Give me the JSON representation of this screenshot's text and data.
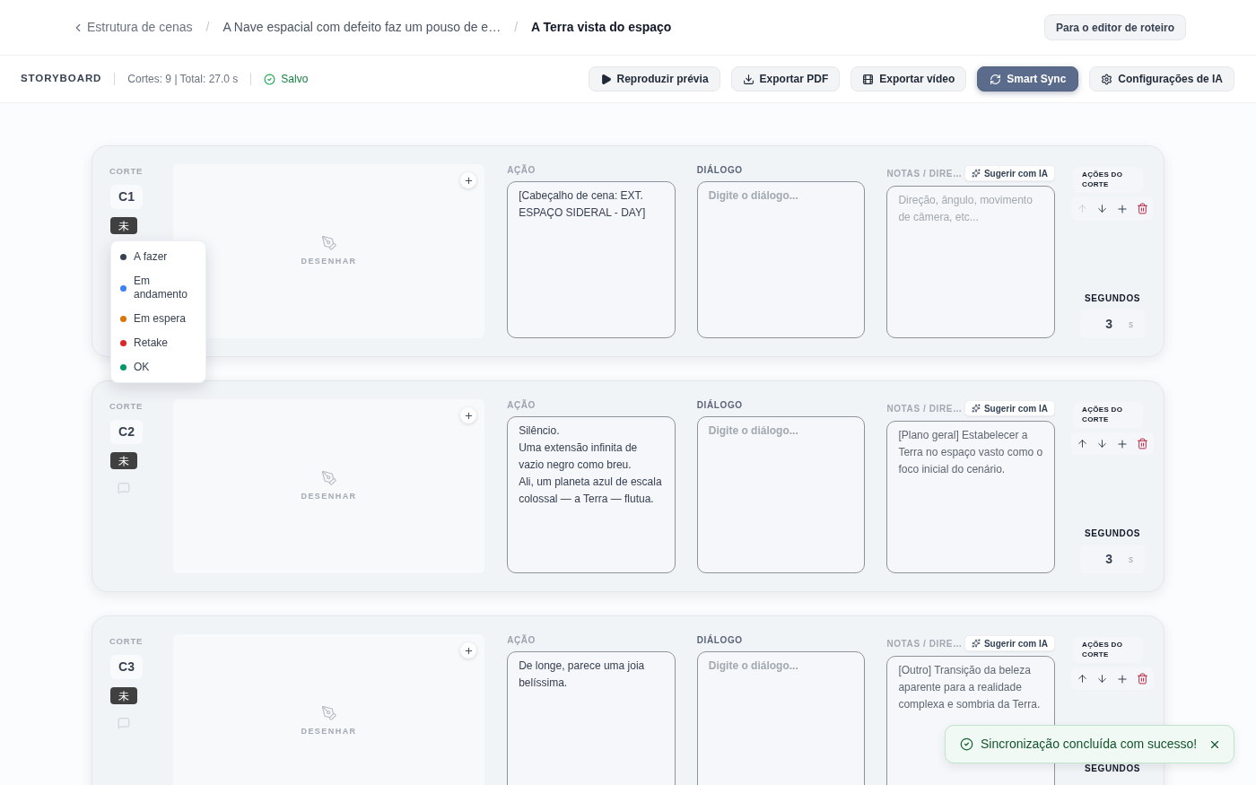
{
  "breadcrumb": {
    "back": "Estrutura de cenas",
    "items": [
      {
        "separator": "/",
        "label": "A Nave espacial com defeito faz um pouso de e…",
        "current": false
      },
      {
        "separator": "/",
        "label": "A Terra vista do espaço",
        "current": true
      }
    ]
  },
  "header_button": "Para o editor de roteiro",
  "toolbar": {
    "title": "STORYBOARD",
    "stats": "Cortes: 9 | Total: 27.0 s",
    "save_status": "Salvo",
    "buttons": [
      {
        "kind": "play",
        "label": "Reproduzir prévia",
        "primary": false
      },
      {
        "kind": "pdf",
        "label": "Exportar PDF",
        "primary": false
      },
      {
        "kind": "video",
        "label": "Exportar vídeo",
        "primary": false
      },
      {
        "kind": "sync",
        "label": "Smart Sync",
        "primary": true
      },
      {
        "kind": "settings",
        "label": "Configurações de IA",
        "primary": false
      }
    ]
  },
  "cuts": [
    {
      "cut_label": "CORTE",
      "number": "C1",
      "status": "未",
      "status_menu": [
        {
          "label": "A fazer",
          "color": "#374151"
        },
        {
          "label": "Em andamento",
          "color": "#3b82f6"
        },
        {
          "label": "Em espera",
          "color": "#d97706"
        },
        {
          "label": "Retake",
          "color": "#dc2626"
        },
        {
          "label": "OK",
          "color": "#059669"
        }
      ],
      "drawing_label": "DESENHAR",
      "action": {
        "label": "AÇÃO",
        "value": "[Cabeçalho de cena: EXT. ESPAÇO SIDERAL - DAY]"
      },
      "dialogue": {
        "label": "DIÁLOGO",
        "placeholder": "Digite o diálogo..."
      },
      "notes": {
        "label": "NOTAS / DIRE…",
        "suggest": "Sugerir com IA",
        "placeholder": "Direção, ângulo, movimento de câmera, etc..."
      },
      "actions_label": "AÇÕES DO CORTE",
      "move_up_disabled": true,
      "seconds_label": "SEGUNDOS",
      "seconds": "3",
      "seconds_unit": "s"
    },
    {
      "cut_label": "CORTE",
      "number": "C2",
      "status": "未",
      "drawing_label": "DESENHAR",
      "action": {
        "label": "AÇÃO",
        "value": "Silêncio.\nUma extensão infinita de vazio negro como breu.\nAli, um planeta azul de escala colossal — a Terra — flutua."
      },
      "dialogue": {
        "label": "DIÁLOGO",
        "placeholder": "Digite o diálogo..."
      },
      "notes": {
        "label": "NOTAS / DIRE…",
        "suggest": "Sugerir com IA",
        "value": "[Plano geral] Estabelecer a Terra no espaço vasto como o foco inicial do cenário."
      },
      "actions_label": "AÇÕES DO CORTE",
      "move_up_disabled": false,
      "seconds_label": "SEGUNDOS",
      "seconds": "3",
      "seconds_unit": "s"
    },
    {
      "cut_label": "CORTE",
      "number": "C3",
      "status": "未",
      "drawing_label": "DESENHAR",
      "action": {
        "label": "AÇÃO",
        "value": "De longe, parece uma joia belíssima."
      },
      "dialogue": {
        "label": "DIÁLOGO",
        "placeholder": "Digite o diálogo..."
      },
      "notes": {
        "label": "NOTAS / DIRE…",
        "suggest": "Sugerir com IA",
        "value": "[Outro] Transição da beleza aparente para a realidade complexa e sombria da Terra."
      },
      "actions_label": "AÇÕES DO CORTE",
      "move_up_disabled": false,
      "seconds_label": "SEGUNDOS"
    }
  ],
  "toast": {
    "kind": "success",
    "message": "Sincronização concluída com sucesso!"
  }
}
